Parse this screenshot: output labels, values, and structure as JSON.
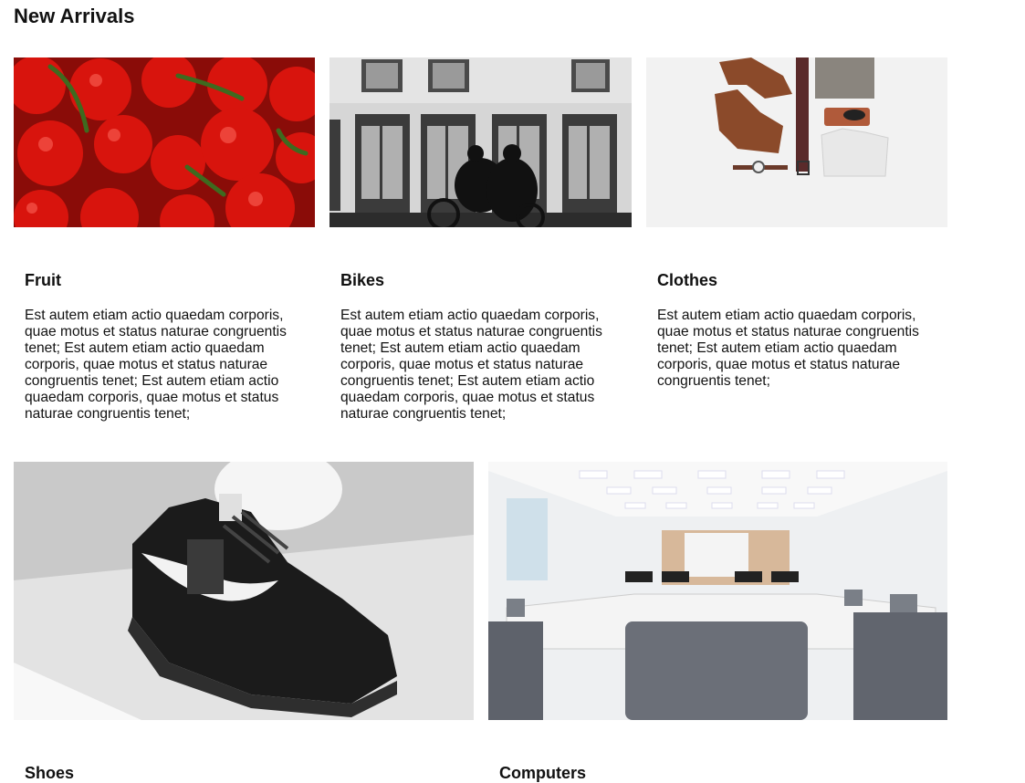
{
  "page": {
    "title": "New Arrivals"
  },
  "cards": [
    {
      "title": "Fruit",
      "text": "Est autem etiam actio quaedam corporis, quae motus et status naturae congruentis tenet; Est autem etiam actio quaedam corporis, quae motus et status naturae congruentis tenet; Est autem etiam actio quaedam corporis, quae motus et status naturae congruentis tenet;"
    },
    {
      "title": "Bikes",
      "text": "Est autem etiam actio quaedam corporis, quae motus et status naturae congruentis tenet; Est autem etiam actio quaedam corporis, quae motus et status naturae congruentis tenet; Est autem etiam actio quaedam corporis, quae motus et status naturae congruentis tenet;"
    },
    {
      "title": "Clothes",
      "text": "Est autem etiam actio quaedam corporis, quae motus et status naturae congruentis tenet; Est autem etiam actio quaedam corporis, quae motus et status naturae congruentis tenet;"
    },
    {
      "title": "Shoes"
    },
    {
      "title": "Computers"
    }
  ]
}
